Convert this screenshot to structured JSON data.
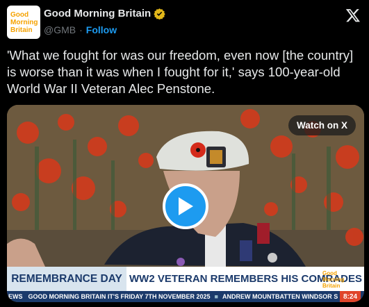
{
  "account": {
    "avatar_lines": [
      "Good",
      "Morning",
      "Britain"
    ],
    "name": "Good Morning Britain",
    "handle": "@GMB",
    "separator": "·",
    "follow_label": "Follow",
    "verified_color": "#e2b719"
  },
  "tweet": {
    "text": "'What we fought for was our freedom, even now [the country] is worse than it was when I fought for it,' says 100-year-old World War II Veteran Alec Penstone."
  },
  "video": {
    "watch_label": "Watch on X",
    "play_icon": "play-icon",
    "lower_third": {
      "left_label": "REMEMBRANCE DAY",
      "right_label": "WW2 VETERAN REMEMBERS HIS COMRADES",
      "logo_lines": [
        "Good",
        "Morning",
        "Britain"
      ]
    },
    "ticker": {
      "prefix": "EWS",
      "item1": "GOOD MORNING BRITAIN IT'S FRIDAY 7TH NOVEMBER 2025",
      "item2": "ANDREW MOUNTBATTEN WINDSOR S",
      "clock": "8:24"
    }
  },
  "colors": {
    "accent": "#1d9bf0",
    "brand_yellow": "#f5a200",
    "ticker_blue": "#1b3a6b",
    "clock_red": "#e0452b"
  }
}
